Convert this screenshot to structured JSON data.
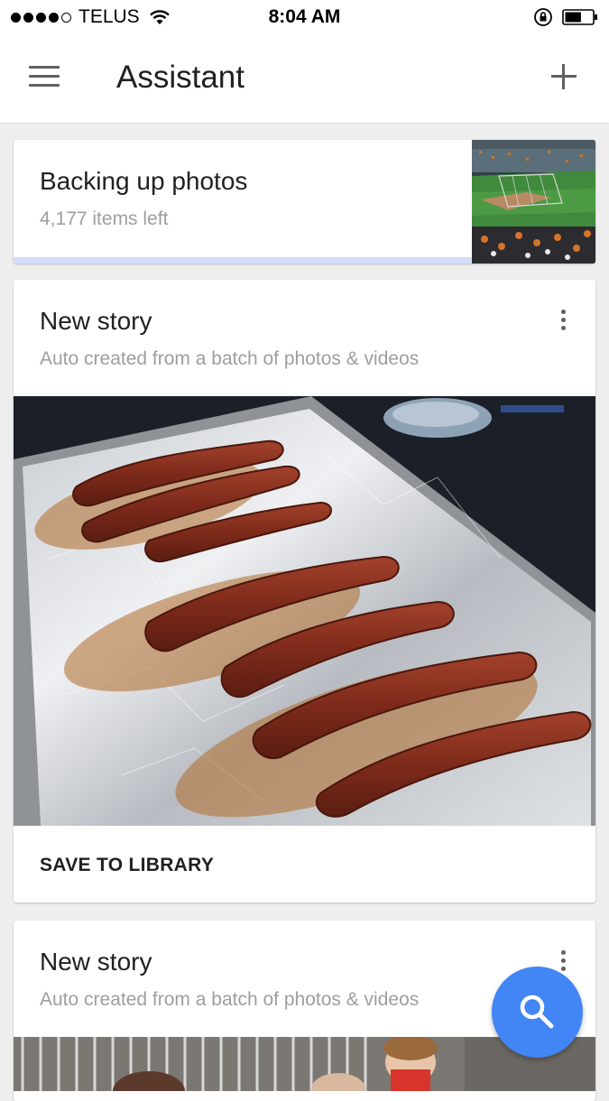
{
  "status_bar": {
    "carrier": "TELUS",
    "time": "8:04 AM",
    "signal_strength": 4,
    "signal_max": 5,
    "battery_level": 0.6
  },
  "app_bar": {
    "title": "Assistant",
    "menu_icon": "menu-icon",
    "action_icon": "add-icon"
  },
  "backup_card": {
    "title": "Backing up photos",
    "subtitle": "4,177 items left",
    "thumbnail": "baseball-stadium-photo"
  },
  "stories": [
    {
      "title": "New story",
      "subtitle": "Auto created from a batch of photos & videos",
      "image": "bacon-on-baking-sheet-photo",
      "action_label": "SAVE TO LIBRARY"
    },
    {
      "title": "New story",
      "subtitle": "Auto created from a batch of photos & videos",
      "image": "children-outdoors-photo"
    }
  ],
  "fab": {
    "icon": "search-icon",
    "color": "#4285f4"
  },
  "colors": {
    "accent": "#4285f4",
    "progress_track": "#d3def8",
    "background": "#eeeeee"
  }
}
